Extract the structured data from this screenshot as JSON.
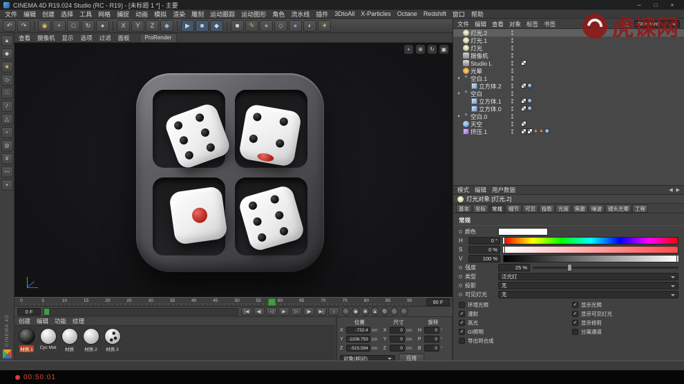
{
  "window": {
    "title": "CINEMA 4D R19.024 Studio (RC - R19) - [未标题 1 *] - 主要",
    "minimize": "─",
    "maximize": "□",
    "close": "×"
  },
  "watermark": {
    "text": "虎课网",
    "color": "#8d1b1b"
  },
  "menu_bar": [
    "文件",
    "编辑",
    "创建",
    "选择",
    "工具",
    "网格",
    "捕捉",
    "动画",
    "模拟",
    "渲染",
    "雕刻",
    "运动跟踪",
    "运动图形",
    "角色",
    "流水线",
    "插件",
    "3DtoAll",
    "X-Particles",
    "Octane",
    "Redshift",
    "窗口",
    "帮助"
  ],
  "toolbar_icons": [
    {
      "name": "undo-icon",
      "glyph": "↶"
    },
    {
      "name": "redo-icon",
      "glyph": "↷"
    },
    {
      "sep": true
    },
    {
      "name": "live-selection-icon",
      "glyph": "◉",
      "fg": "#e3c35a"
    },
    {
      "name": "move-tool-icon",
      "glyph": "+"
    },
    {
      "name": "scale-tool-icon",
      "glyph": "□"
    },
    {
      "name": "rotate-tool-icon",
      "glyph": "↻"
    },
    {
      "name": "last-tool-icon",
      "glyph": "●",
      "fg": "#a9c7e8"
    },
    {
      "sep": true
    },
    {
      "name": "lock-x-axis-icon",
      "glyph": "X"
    },
    {
      "name": "lock-y-axis-icon",
      "glyph": "Y"
    },
    {
      "name": "lock-z-axis-icon",
      "glyph": "Z"
    },
    {
      "name": "coordinate-system-icon",
      "glyph": "◆",
      "fg": "#8fb5e0"
    },
    {
      "sep": true
    },
    {
      "name": "render-view-icon",
      "glyph": "▶",
      "fg": "#bcd6ee",
      "bg": "#46566a"
    },
    {
      "name": "render-picture-viewer-icon",
      "glyph": "■",
      "fg": "#bcd6ee",
      "bg": "#46566a"
    },
    {
      "name": "render-settings-icon",
      "glyph": "◆",
      "fg": "#d8d8d8",
      "bg": "#46566a"
    },
    {
      "sep": true
    },
    {
      "name": "cube-primitive-icon",
      "glyph": "■",
      "fg": "#cfe0f2"
    },
    {
      "name": "spline-pen-icon",
      "glyph": "✎",
      "fg": "#9ac96e"
    },
    {
      "name": "subdivision-surface-icon",
      "glyph": "●",
      "fg": "#b48ccb"
    },
    {
      "name": "deformer-icon",
      "glyph": "◇",
      "fg": "#8fd0a0"
    },
    {
      "name": "environment-icon",
      "glyph": "●",
      "fg": "#6fa7d8"
    },
    {
      "name": "camera-icon",
      "glyph": "◐",
      "fg": "#cfcfcf"
    },
    {
      "name": "light-icon",
      "glyph": "☀",
      "fg": "#e8d06a"
    }
  ],
  "left_toolbar_icons": [
    {
      "name": "make-editable-icon",
      "glyph": "▲"
    },
    {
      "name": "model-mode-icon",
      "glyph": "◆"
    },
    {
      "name": "texture-mode-icon",
      "glyph": "■",
      "fg": "#d2a75a"
    },
    {
      "name": "workplane-mode-icon",
      "glyph": "◇"
    },
    {
      "name": "points-mode-icon",
      "glyph": "∴"
    },
    {
      "name": "edges-mode-icon",
      "glyph": "/"
    },
    {
      "name": "polygons-mode-icon",
      "glyph": "△"
    },
    {
      "name": "enable-axis-icon",
      "glyph": "+",
      "fg": "#d2a75a"
    },
    {
      "name": "viewport-solo-icon",
      "glyph": "◎"
    },
    {
      "name": "enable-snap-icon",
      "glyph": "#"
    },
    {
      "name": "workplane-snap-icon",
      "glyph": "—"
    },
    {
      "name": "lock-workplane-icon",
      "glyph": "▪"
    }
  ],
  "viewport": {
    "menu": [
      "查看",
      "摄像机",
      "显示",
      "选项",
      "过滤",
      "面板"
    ],
    "prorender_tab": "ProRender",
    "corner_tools": [
      {
        "name": "pan-view-icon",
        "glyph": "+"
      },
      {
        "name": "zoom-view-icon",
        "glyph": "⊕"
      },
      {
        "name": "orbit-view-icon",
        "glyph": "↻"
      },
      {
        "name": "maximize-view-icon",
        "glyph": "▣"
      }
    ]
  },
  "object_manager": {
    "menu": [
      "文件",
      "编辑",
      "查看",
      "对象",
      "标签",
      "书签"
    ],
    "layout_select": "Standard",
    "rows": [
      {
        "label": "灯光.2",
        "icon": "light",
        "indent": 0,
        "selected": true,
        "tags": []
      },
      {
        "label": "灯光.1",
        "icon": "light",
        "indent": 0,
        "tags": []
      },
      {
        "label": "灯光",
        "icon": "light",
        "indent": 0,
        "tags": []
      },
      {
        "label": "摄像机",
        "icon": "camera",
        "indent": 0,
        "tags": []
      },
      {
        "label": "Studio L",
        "icon": "studio",
        "indent": 0,
        "tags": [
          "texture"
        ]
      },
      {
        "label": "光晕",
        "icon": "glow",
        "indent": 0,
        "tags": []
      },
      {
        "label": "空白.1",
        "icon": "null",
        "indent": 0,
        "group": true,
        "tags": []
      },
      {
        "label": "立方体.2",
        "icon": "cube",
        "indent": 1,
        "tags": [
          "texture",
          "phong"
        ]
      },
      {
        "label": "空白",
        "icon": "null",
        "indent": 0,
        "group": true,
        "tags": []
      },
      {
        "label": "立方体.1",
        "icon": "cube",
        "indent": 1,
        "tags": [
          "texture",
          "phong"
        ]
      },
      {
        "label": "立方体.0",
        "icon": "cube",
        "indent": 1,
        "tags": [
          "texture",
          "phong"
        ]
      },
      {
        "label": "空白.0",
        "icon": "null",
        "indent": 0,
        "group": true,
        "tags": []
      },
      {
        "label": "天空",
        "icon": "sky",
        "indent": 0,
        "tags": [
          "texture"
        ]
      },
      {
        "label": "挤压.1",
        "icon": "extrude",
        "indent": 0,
        "tags": [
          "texture",
          "texture",
          "warning",
          "warning",
          "phong"
        ]
      }
    ]
  },
  "attributes": {
    "menu": [
      "模式",
      "编辑",
      "用户数据"
    ],
    "nav": {
      "back": "◀",
      "forward": "▶"
    },
    "title": "灯光对象 [灯光.2]",
    "tabs": [
      "基本",
      "坐标",
      "常规",
      "细节",
      "可见",
      "投影",
      "光度",
      "焦散",
      "噪波",
      "镜头光晕",
      "工程"
    ],
    "active_tab": "常规",
    "section": "常规",
    "color_label": "颜色",
    "hsv": [
      {
        "label": "H",
        "display": "0 °",
        "pos": 0
      },
      {
        "label": "S",
        "display": "0 %",
        "pos": 0
      },
      {
        "label": "V",
        "display": "100 %",
        "pos": 100
      }
    ],
    "intensity": {
      "label": "强度",
      "display": "25 %",
      "percent": 25
    },
    "dropdowns": [
      {
        "label": "类型",
        "value": "泛光灯"
      },
      {
        "label": "投影",
        "value": "无"
      },
      {
        "label": "可见灯光",
        "value": "无"
      }
    ],
    "checks_left": [
      {
        "label": "环境光照",
        "checked": false
      },
      {
        "label": "漫射",
        "checked": true
      },
      {
        "label": "高光",
        "checked": true
      },
      {
        "label": "GI照明",
        "checked": true
      },
      {
        "label": "导出到合成",
        "checked": false
      }
    ],
    "checks_right": [
      {
        "label": "显示光照",
        "checked": true
      },
      {
        "label": "显示可见灯光",
        "checked": true
      },
      {
        "label": "显示修剪",
        "checked": true
      },
      {
        "label": "分离通道",
        "checked": false
      }
    ]
  },
  "timeline": {
    "labels": [
      0,
      5,
      10,
      15,
      20,
      25,
      30,
      35,
      40,
      45,
      50,
      55,
      60,
      65,
      70,
      75,
      80,
      85,
      90
    ],
    "total": 91,
    "current_frame": 58,
    "start_field": "0 F",
    "end_field": "90 F"
  },
  "transport_buttons": [
    {
      "name": "goto-start-button",
      "glyph": "|◀"
    },
    {
      "name": "prev-key-button",
      "glyph": "◀|"
    },
    {
      "name": "prev-frame-button",
      "glyph": "◁"
    },
    {
      "name": "play-button",
      "glyph": "▶"
    },
    {
      "name": "next-frame-button",
      "glyph": "▷"
    },
    {
      "name": "next-key-button",
      "glyph": "|▶"
    },
    {
      "name": "goto-end-button",
      "glyph": "▶|"
    },
    {
      "name": "play-sound-button",
      "glyph": "♪"
    }
  ],
  "record_buttons": [
    {
      "name": "record-keyframe-button",
      "glyph": "●",
      "color": "#e05545"
    },
    {
      "name": "autokey-button",
      "glyph": "◆"
    },
    {
      "name": "record-position-button",
      "glyph": "■"
    },
    {
      "name": "record-scale-button",
      "glyph": "▲"
    },
    {
      "name": "record-rotation-button",
      "glyph": "↻"
    },
    {
      "name": "record-parameter-button",
      "glyph": "◇"
    },
    {
      "name": "record-pla-button",
      "glyph": "○"
    }
  ],
  "materials": {
    "menu": [
      "创建",
      "编辑",
      "功能",
      "纹理"
    ],
    "items": [
      {
        "name": "材质.1",
        "style": "dark",
        "selected": true
      },
      {
        "name": "Cyc Mat",
        "style": "white"
      },
      {
        "name": "材质",
        "style": "white"
      },
      {
        "name": "材质.2",
        "style": "white"
      },
      {
        "name": "材质.3",
        "style": "dice"
      }
    ]
  },
  "coordinates": {
    "groups": [
      {
        "title": "位置",
        "rows": [
          {
            "axis": "X",
            "value": "-732.4",
            "unit": "cm"
          },
          {
            "axis": "Y",
            "value": "-1108.753",
            "unit": "cm"
          },
          {
            "axis": "Z",
            "value": "-515.594",
            "unit": "cm"
          }
        ]
      },
      {
        "title": "尺寸",
        "rows": [
          {
            "axis": "X",
            "value": "0",
            "unit": "cm"
          },
          {
            "axis": "Y",
            "value": "0",
            "unit": "cm"
          },
          {
            "axis": "Z",
            "value": "0",
            "unit": "cm"
          }
        ]
      },
      {
        "title": "旋转",
        "rows": [
          {
            "axis": "H",
            "value": "0",
            "unit": "°"
          },
          {
            "axis": "P",
            "value": "0",
            "unit": "°"
          },
          {
            "axis": "B",
            "value": "0",
            "unit": "°"
          }
        ]
      }
    ],
    "mode": "对象(相对)",
    "apply": "应用"
  },
  "status": {
    "recording_time": "00:50:01",
    "brand_vertical": "CINEMA 4D"
  }
}
